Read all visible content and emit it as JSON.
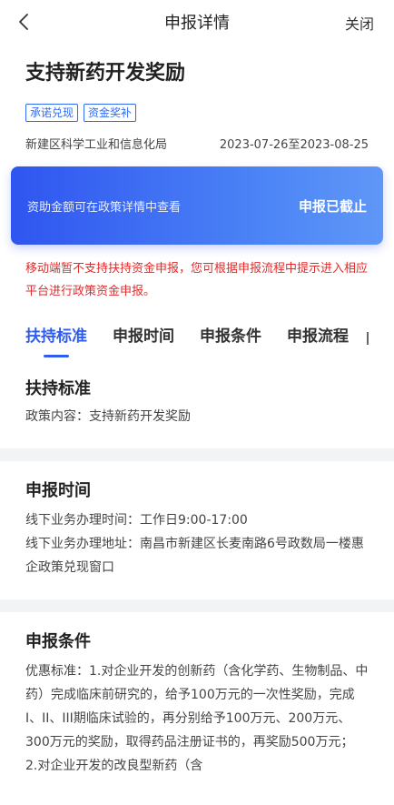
{
  "nav": {
    "title": "申报详情",
    "close_label": "关闭",
    "back_icon": "chevron-left-icon"
  },
  "policy": {
    "title": "支持新药开发奖励",
    "tags": [
      "承诺兑现",
      "资金奖补"
    ],
    "department": "新建区科学工业和信息化局",
    "date_range": "2023-07-26至2023-08-25"
  },
  "banner": {
    "hint": "资助金额可在政策详情中查看",
    "status": "申报已截止"
  },
  "warning": "移动端暂不支持扶持资金申报，您可根据申报流程中提示进入相应平台进行政策资金申报。",
  "tabs": [
    "扶持标准",
    "申报时间",
    "申报条件",
    "申报流程"
  ],
  "sections": {
    "standard": {
      "title": "扶持标准",
      "content": "政策内容：支持新药开发奖励"
    },
    "time": {
      "title": "申报时间",
      "hours": "线下业务办理时间：工作日9:00-17:00",
      "address": "线下业务办理地址：南昌市新建区长麦南路6号政数局一楼惠企政策兑现窗口"
    },
    "conditions": {
      "title": "申报条件",
      "content": "优惠标准：1.对企业开发的创新药（含化学药、生物制品、中药）完成临床前研究的，给予100万元的一次性奖励，完成I、II、III期临床试验的，再分别给予100万元、200万元、300万元的奖励，取得药品注册证书的，再奖励500万元； 2.对企业开发的改良型新药（含"
    }
  },
  "colors": {
    "accent": "#2f5cf0",
    "warning": "#e22b2b",
    "banner_start": "#2f55f0",
    "banner_end": "#5f97f7"
  }
}
